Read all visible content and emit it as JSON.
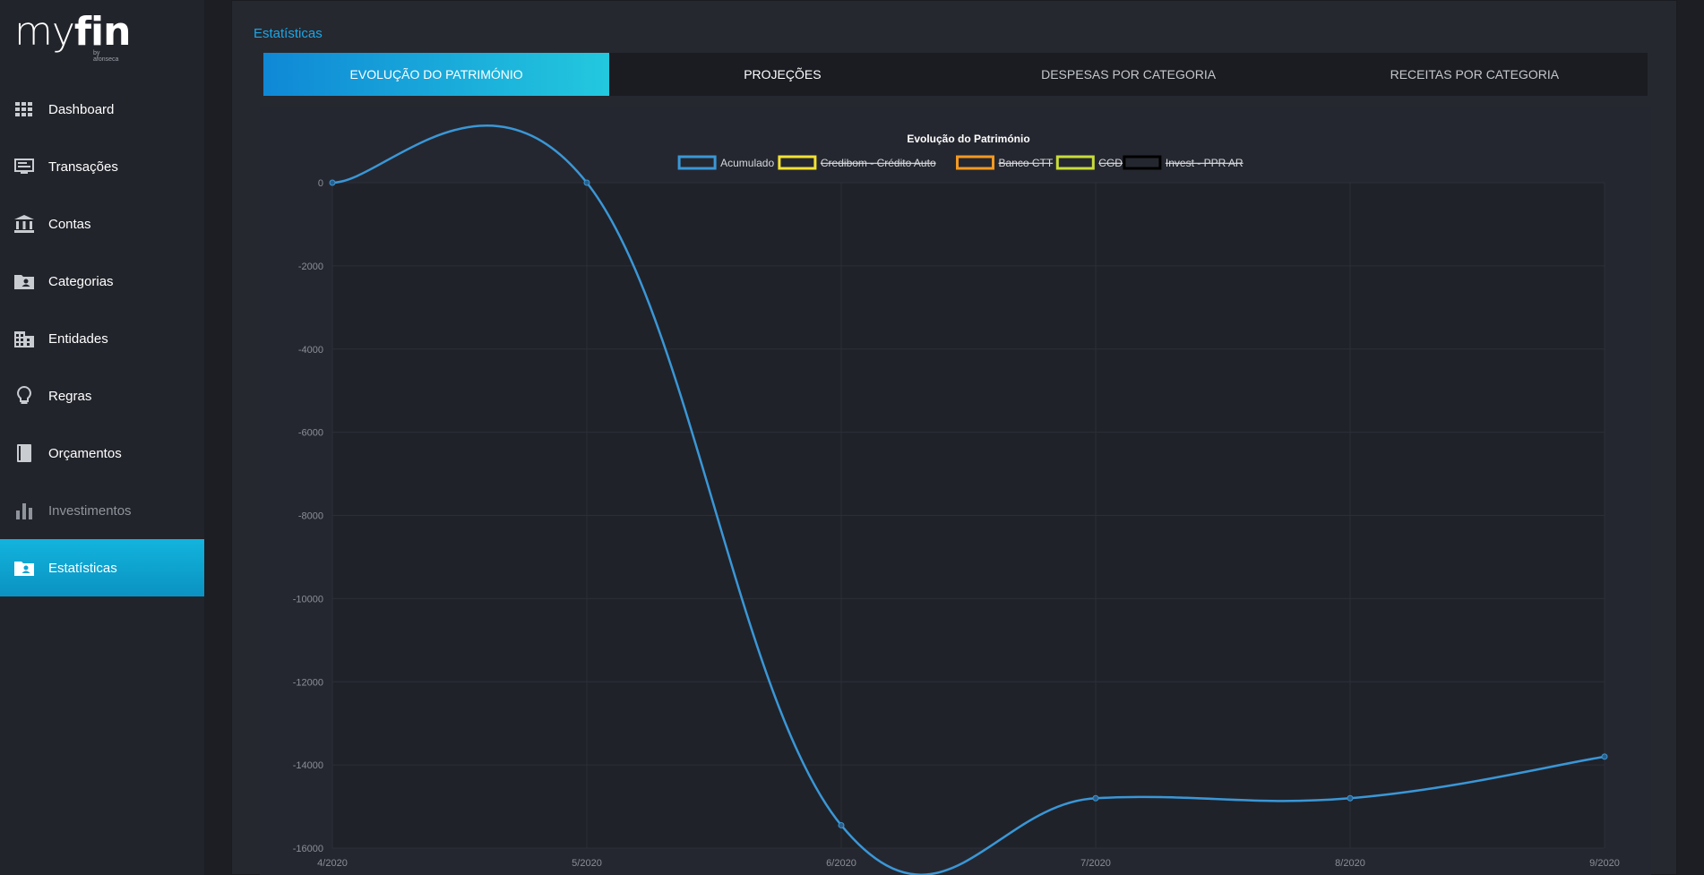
{
  "app": {
    "logo_text_light": "my",
    "logo_text_bold": "fin",
    "logo_by": "by afonseca"
  },
  "sidebar": {
    "items": [
      {
        "label": "Dashboard",
        "icon": "grid-icon"
      },
      {
        "label": "Transações",
        "icon": "monitor-icon"
      },
      {
        "label": "Contas",
        "icon": "bank-icon"
      },
      {
        "label": "Categorias",
        "icon": "folder-user-icon"
      },
      {
        "label": "Entidades",
        "icon": "building-icon"
      },
      {
        "label": "Regras",
        "icon": "lightbulb-icon"
      },
      {
        "label": "Orçamentos",
        "icon": "book-icon"
      },
      {
        "label": "Investimentos",
        "icon": "bar-chart-icon"
      },
      {
        "label": "Estatísticas",
        "icon": "folder-user-icon"
      }
    ],
    "active_index": 8
  },
  "main": {
    "section_title": "Estatísticas",
    "tabs": [
      {
        "label": "EVOLUÇÃO DO PATRIMÓNIO"
      },
      {
        "label": "PROJEÇÕES"
      },
      {
        "label": "DESPESAS POR CATEGORIA"
      },
      {
        "label": "RECEITAS POR CATEGORIA"
      }
    ],
    "active_tab": 0
  },
  "colors": {
    "accent": "#1aa7e6",
    "line": "#3a97d6"
  },
  "chart_data": {
    "type": "line",
    "title": "Evolução do Património",
    "x": [
      "4/2020",
      "5/2020",
      "6/2020",
      "7/2020",
      "8/2020",
      "9/2020"
    ],
    "ylim": [
      -16000,
      0
    ],
    "yticks": [
      0,
      -2000,
      -4000,
      -6000,
      -8000,
      -10000,
      -12000,
      -14000,
      -16000
    ],
    "grid": true,
    "legend_position": "top",
    "legend": [
      {
        "name": "Acumulado",
        "color": "#3a97d6",
        "hidden": false
      },
      {
        "name": "Credibom - Crédito Auto",
        "color": "#f2e233",
        "hidden": true
      },
      {
        "name": "Banco CTT",
        "color": "#f29a23",
        "hidden": true
      },
      {
        "name": "CGD",
        "color": "#c8dc3a",
        "hidden": true
      },
      {
        "name": "Invest - PPR AR",
        "color": "#000000",
        "hidden": true
      }
    ],
    "series": [
      {
        "name": "Acumulado",
        "values": [
          0,
          0,
          -15450,
          -14800,
          -14800,
          -13800
        ]
      }
    ]
  }
}
